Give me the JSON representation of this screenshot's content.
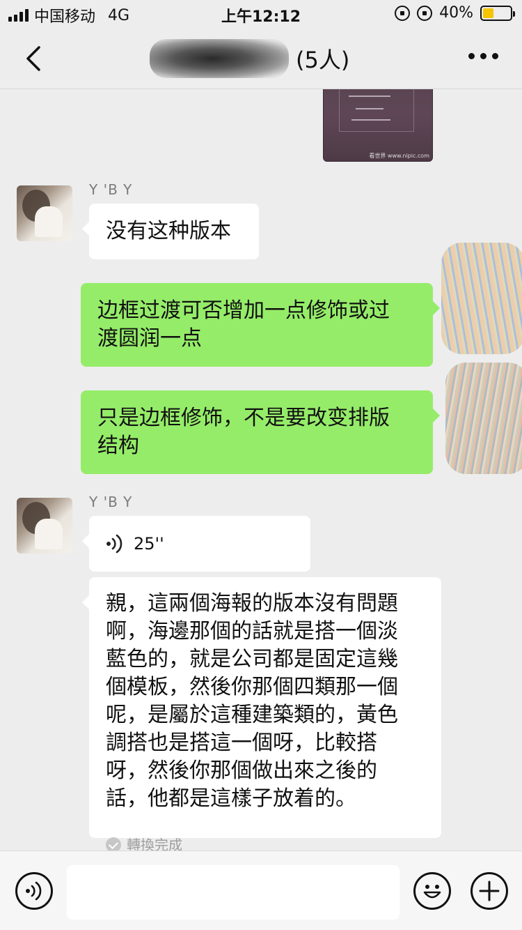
{
  "status_bar": {
    "carrier": "中国移动",
    "network": "4G",
    "time": "上午12:12",
    "battery_percent": "40%",
    "battery_level": 0.4,
    "icons": [
      "orientation-lock-icon",
      "alarm-icon",
      "battery-icon"
    ]
  },
  "nav": {
    "back_icon": "chevron-left-icon",
    "title_suffix": "(5人)",
    "more_icon": "more-dots-icon"
  },
  "messages": [
    {
      "type": "image",
      "side": "right",
      "caption": "看世界 www.nipic.com"
    },
    {
      "type": "text",
      "side": "left",
      "sender": "Y 'B Y",
      "lines": [
        "没有这种版本"
      ]
    },
    {
      "type": "text",
      "side": "right",
      "lines": [
        "边框过渡可否增加一点修饰或过",
        "渡圆润一点"
      ]
    },
    {
      "type": "text",
      "side": "right",
      "lines": [
        "只是边框修饰，不是要改变排版",
        "结构"
      ]
    },
    {
      "type": "voice",
      "side": "left",
      "sender": "Y 'B Y",
      "duration": "25''"
    },
    {
      "type": "transcript",
      "side": "left",
      "lines": [
        "親，這兩個海報的版本沒有問題",
        "啊，海邊那個的話就是搭一個淡",
        "藍色的，就是公司都是固定這幾",
        "個模板，然後你那個四類那一個",
        "呢，是屬於這種建築類的，黃色",
        "調搭也是搭這一個呀，比較搭",
        "呀，然後你那個做出來之後的",
        "話，他都是這樣子放着的。"
      ],
      "status": "轉換完成"
    }
  ],
  "input_bar": {
    "voice_icon": "voice-mode-icon",
    "input_value": "",
    "emoji_icon": "emoji-icon",
    "plus_icon": "plus-icon"
  },
  "colors": {
    "background": "#ededed",
    "bubble_right": "#95ec69",
    "bubble_left": "#ffffff",
    "battery_fill": "#f7c500"
  }
}
